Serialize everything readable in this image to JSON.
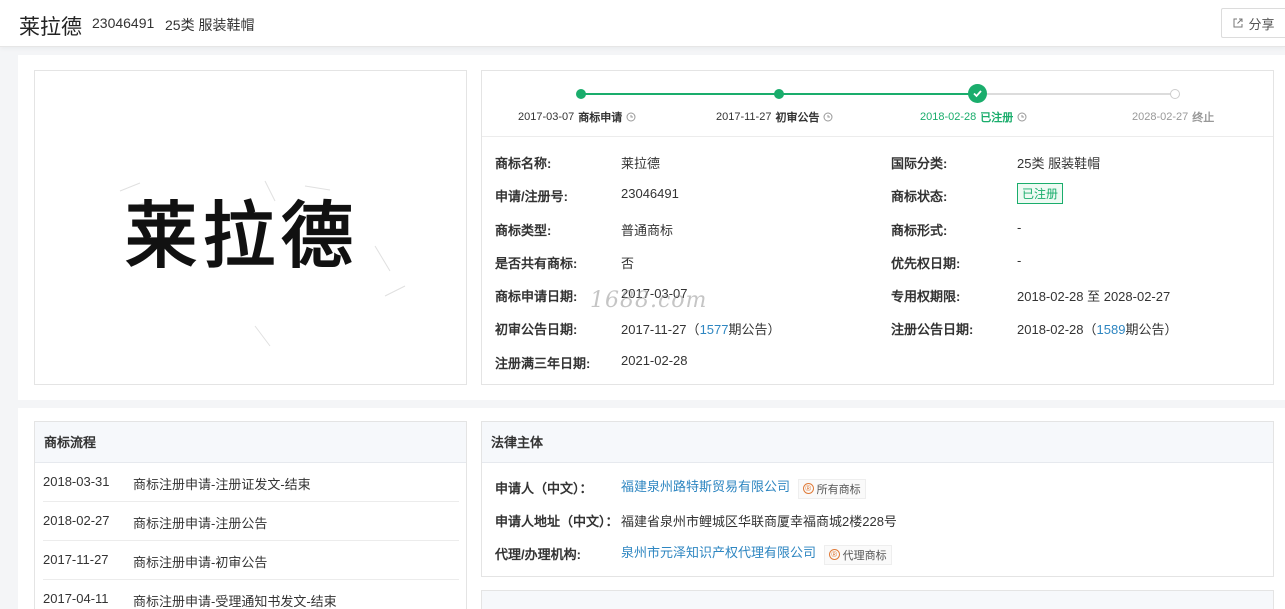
{
  "header": {
    "title": "莱拉德",
    "reg_no": "23046491",
    "class_label": "25类 服装鞋帽",
    "share_label": "分享"
  },
  "mark_image": {
    "text": "莱拉德"
  },
  "timeline": [
    {
      "date": "2017-03-07",
      "label": "商标申请",
      "state": "done"
    },
    {
      "date": "2017-11-27",
      "label": "初审公告",
      "state": "done"
    },
    {
      "date": "2018-02-28",
      "label": "已注册",
      "state": "current"
    },
    {
      "date": "2028-02-27",
      "label": "终止",
      "state": "future"
    }
  ],
  "info": {
    "name_label": "商标名称:",
    "name_value": "莱拉德",
    "intl_class_label": "国际分类:",
    "intl_class_value": "25类 服装鞋帽",
    "reg_no_label": "申请/注册号:",
    "reg_no_value": "23046491",
    "status_label": "商标状态:",
    "status_value": "已注册",
    "type_label": "商标类型:",
    "type_value": "普通商标",
    "form_label": "商标形式:",
    "form_value": "-",
    "shared_label": "是否共有商标:",
    "shared_value": "否",
    "priority_label": "优先权日期:",
    "priority_value": "-",
    "apply_date_label": "商标申请日期:",
    "apply_date_value": "2017-03-07",
    "exclusive_label": "专用权期限:",
    "exclusive_value": "2018-02-28 至 2028-02-27",
    "prelim_label": "初审公告日期:",
    "prelim_date": "2017-11-27",
    "prelim_open": "（",
    "prelim_issue": "1577",
    "prelim_suffix": "期公告）",
    "reg_pub_label": "注册公告日期:",
    "reg_pub_date": "2018-02-28",
    "reg_pub_open": "（",
    "reg_pub_issue": "1589",
    "reg_pub_suffix": "期公告）",
    "three_year_label": "注册满三年日期:",
    "three_year_value": "2021-02-28"
  },
  "watermark": "1688.com",
  "flow": {
    "title": "商标流程",
    "rows": [
      {
        "date": "2018-03-31",
        "text": "商标注册申请-注册证发文-结束"
      },
      {
        "date": "2018-02-27",
        "text": "商标注册申请-注册公告"
      },
      {
        "date": "2017-11-27",
        "text": "商标注册申请-初审公告"
      },
      {
        "date": "2017-04-11",
        "text": "商标注册申请-受理通知书发文-结束"
      }
    ]
  },
  "legal": {
    "title": "法律主体",
    "applicant_label": "申请人（中文）：",
    "applicant_value": "福建泉州路特斯贸易有限公司",
    "applicant_tag": "所有商标",
    "address_label": "申请人地址（中文）：",
    "address_value": "福建省泉州市鲤城区华联商厦幸福商城2楼228号",
    "agent_label": "代理/办理机构:",
    "agent_value": "泉州市元泽知识产权代理有限公司",
    "agent_tag": "代理商标"
  },
  "colors": {
    "green": "#1aad6c",
    "link": "#2e86c1"
  }
}
